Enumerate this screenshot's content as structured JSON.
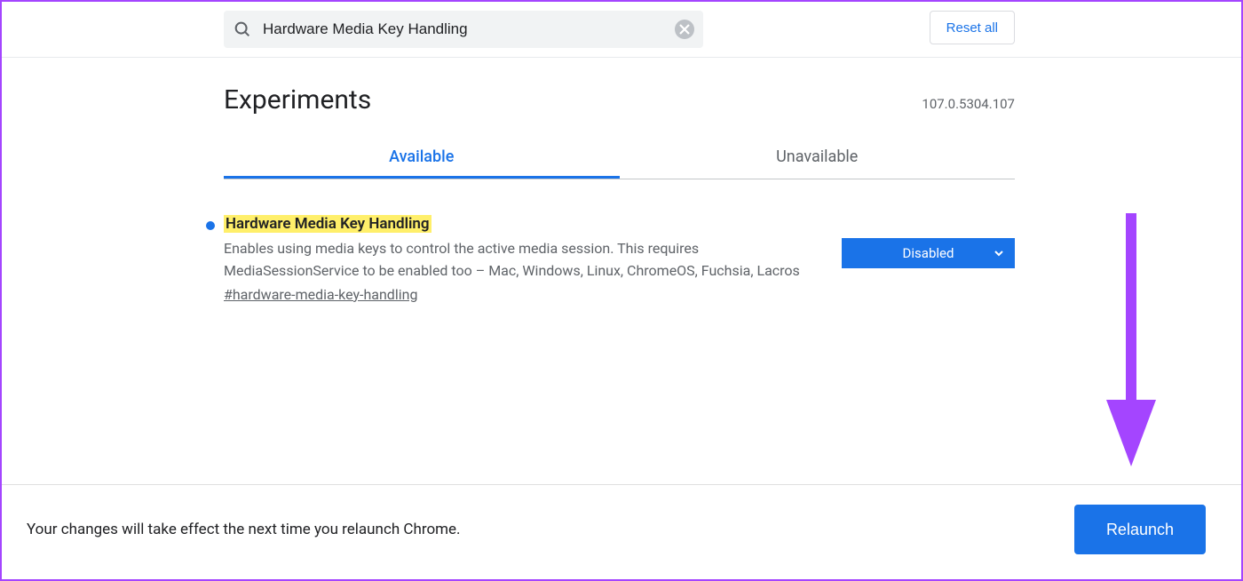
{
  "search": {
    "value": "Hardware Media Key Handling"
  },
  "reset_label": "Reset all",
  "page_title": "Experiments",
  "version": "107.0.5304.107",
  "tabs": {
    "available": "Available",
    "unavailable": "Unavailable",
    "active": "available"
  },
  "flag": {
    "title": "Hardware Media Key Handling",
    "description": "Enables using media keys to control the active media session. This requires MediaSessionService to be enabled too – Mac, Windows, Linux, ChromeOS, Fuchsia, Lacros",
    "hash": "#hardware-media-key-handling",
    "selected": "Disabled"
  },
  "footer": {
    "message": "Your changes will take effect the next time you relaunch Chrome.",
    "button": "Relaunch"
  }
}
